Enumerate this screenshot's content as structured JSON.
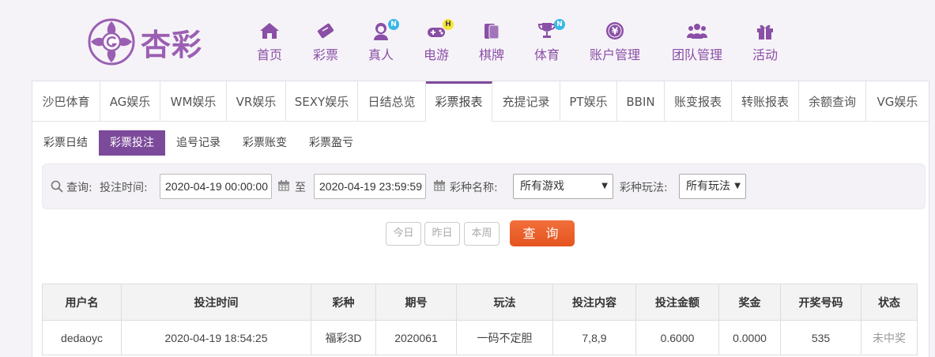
{
  "brand": {
    "name": "杏彩",
    "color": "#9a5fb2"
  },
  "nav": [
    {
      "label": "首页",
      "icon": "home-icon"
    },
    {
      "label": "彩票",
      "icon": "ticket-icon"
    },
    {
      "label": "真人",
      "icon": "live-dealer-icon",
      "badge": "N"
    },
    {
      "label": "电游",
      "icon": "gamepad-icon",
      "badge": "H"
    },
    {
      "label": "棋牌",
      "icon": "cards-icon"
    },
    {
      "label": "体育",
      "icon": "trophy-icon",
      "badge": "N"
    },
    {
      "label": "账户管理",
      "icon": "yen-coin-icon"
    },
    {
      "label": "团队管理",
      "icon": "team-icon"
    },
    {
      "label": "活动",
      "icon": "gift-icon"
    }
  ],
  "tabs": [
    "沙巴体育",
    "AG娱乐",
    "WM娱乐",
    "VR娱乐",
    "SEXY娱乐",
    "日结总览",
    "彩票报表",
    "充提记录",
    "PT娱乐",
    "BBIN",
    "账变报表",
    "转账报表",
    "余额查询",
    "VG娱乐"
  ],
  "active_tab": "彩票报表",
  "subtabs": [
    "彩票日结",
    "彩票投注",
    "追号记录",
    "彩票账变",
    "彩票盈亏"
  ],
  "active_subtab": "彩票投注",
  "filter": {
    "query_label": "查询:",
    "time_label": "投注时间:",
    "start_time": "2020-04-19 00:00:00",
    "to_label": "至",
    "end_time": "2020-04-19 23:59:59",
    "lottery_label": "彩种名称:",
    "lottery_value": "所有游戏",
    "play_label": "彩种玩法:",
    "play_value": "所有玩法"
  },
  "quick_buttons": {
    "today": "今日",
    "yesterday": "昨日",
    "this_week": "本周"
  },
  "query_button": "查 询",
  "table": {
    "headers": [
      "用户名",
      "投注时间",
      "彩种",
      "期号",
      "玩法",
      "投注内容",
      "投注金额",
      "奖金",
      "开奖号码",
      "状态"
    ],
    "rows": [
      [
        "dedaoyc",
        "2020-04-19 18:54:25",
        "福彩3D",
        "2020061",
        "一码不定胆",
        "7,8,9",
        "0.6000",
        "0.0000",
        "535",
        "未中奖"
      ]
    ]
  },
  "colors": {
    "accent": "#7c4a9a",
    "nav_text": "#8a4fa6",
    "query_button": "#e85d26",
    "badge_n": "#39b7e6",
    "badge_h": "#f5e437"
  }
}
